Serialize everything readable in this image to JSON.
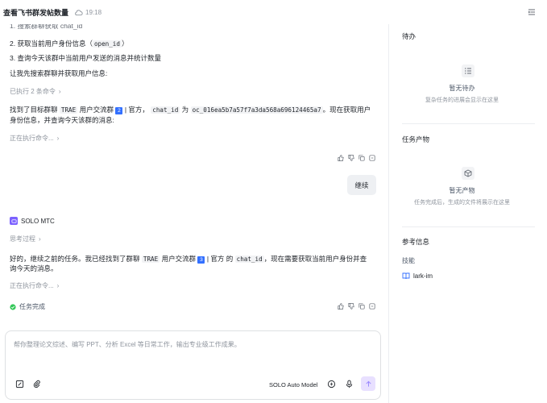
{
  "header": {
    "title": "查看飞书群发帖数量",
    "time": "19:18",
    "icons": [
      "cloud-icon",
      "panel-toggle-icon"
    ]
  },
  "chat": {
    "cut_top_line": "1. 搜索群聊获取 chat_id",
    "step2_prefix": "2. 获取当前用户身份信息（",
    "step2_code": "open_id",
    "step2_suffix": "）",
    "step3": "3. 查询今天该群中当前用户发送的消息并统计数量",
    "search_intro": "让我先搜索群聊并获取用户信息:",
    "executed_commands": "已执行 2 条命令",
    "found_p1": "找到了目标群聊",
    "found_code1a": "TRAE",
    "found_p2": "用户交流群",
    "found_tag": "2",
    "found_p3": "| 官方，",
    "found_code2": "chat_id",
    "found_p4": "为",
    "found_code3": "oc_016ea5b7a57f7a3da568a696124465a7",
    "found_p5": "。现在获取用户",
    "found_line2": "身份信息，并查询今天该群的消息:",
    "running1": "正在执行命令...",
    "user_bubble": "继续",
    "agent_name": "SOLO MTC",
    "thinking": "思考过程",
    "resume_p1": "好的，继续之前的任务。我已经找到了群聊",
    "resume_code1": "TRAE",
    "resume_p2": "用户交流群",
    "resume_tag": "3",
    "resume_p3": "| 官方 的",
    "resume_code2": "chat_id",
    "resume_p4": "，现在需要获取当前用户身份并查",
    "resume_line2": "询今天的消息。",
    "running2": "正在执行命令...",
    "task_done": "任务完成"
  },
  "input": {
    "placeholder": "帮你整理论文综述、编写 PPT、分析 Excel 等日常工作，输出专业级工作成果。",
    "model": "SOLO Auto Model"
  },
  "panel": {
    "todo_title": "待办",
    "todo_empty": "暂无待办",
    "todo_empty_sub": "复杂任务的进展会显示在这里",
    "artifacts_title": "任务产物",
    "artifacts_empty": "暂无产物",
    "artifacts_empty_sub": "任务完成后，生成的文件将展示在这里",
    "ref_title": "参考信息",
    "skills_label": "技能",
    "skill_item": "lark-im"
  },
  "colors": {
    "accent": "#3370ff",
    "agent": "#7b61ff",
    "success": "#34c759",
    "muted": "#8f959e"
  }
}
